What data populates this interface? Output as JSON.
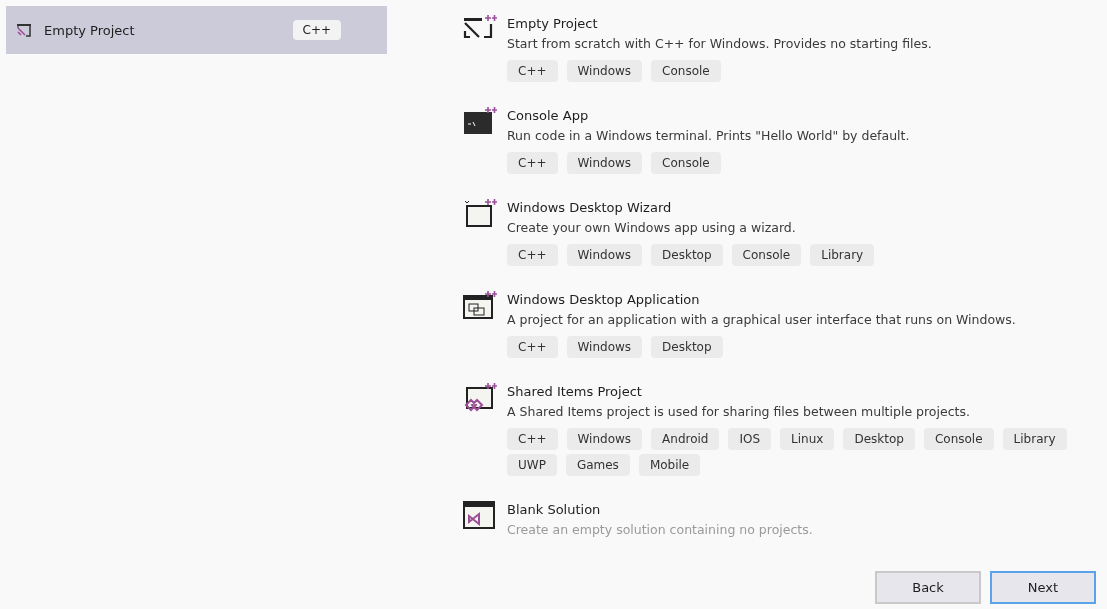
{
  "recent": [
    {
      "name": "Empty Project",
      "tag": "C++",
      "selected": true
    }
  ],
  "templates": [
    {
      "kind": "empty",
      "title": "Empty Project",
      "description": "Start from scratch with C++ for Windows. Provides no starting files.",
      "tags": [
        "C++",
        "Windows",
        "Console"
      ]
    },
    {
      "kind": "console",
      "title": "Console App",
      "description": "Run code in a Windows terminal. Prints \"Hello World\" by default.",
      "tags": [
        "C++",
        "Windows",
        "Console"
      ]
    },
    {
      "kind": "wizard",
      "title": "Windows Desktop Wizard",
      "description": "Create your own Windows app using a wizard.",
      "tags": [
        "C++",
        "Windows",
        "Desktop",
        "Console",
        "Library"
      ]
    },
    {
      "kind": "desktop",
      "title": "Windows Desktop Application",
      "description": "A project for an application with a graphical user interface that runs on Windows.",
      "tags": [
        "C++",
        "Windows",
        "Desktop"
      ]
    },
    {
      "kind": "shared",
      "title": "Shared Items Project",
      "description": "A Shared Items project is used for sharing files between multiple projects.",
      "tags": [
        "C++",
        "Windows",
        "Android",
        "IOS",
        "Linux",
        "Desktop",
        "Console",
        "Library",
        "UWP",
        "Games",
        "Mobile"
      ]
    },
    {
      "kind": "blank",
      "title": "Blank Solution",
      "description": "Create an empty solution containing no projects."
    }
  ],
  "buttons": [
    {
      "label": "Back",
      "selected": false
    },
    {
      "label": "Next",
      "selected": true
    }
  ]
}
